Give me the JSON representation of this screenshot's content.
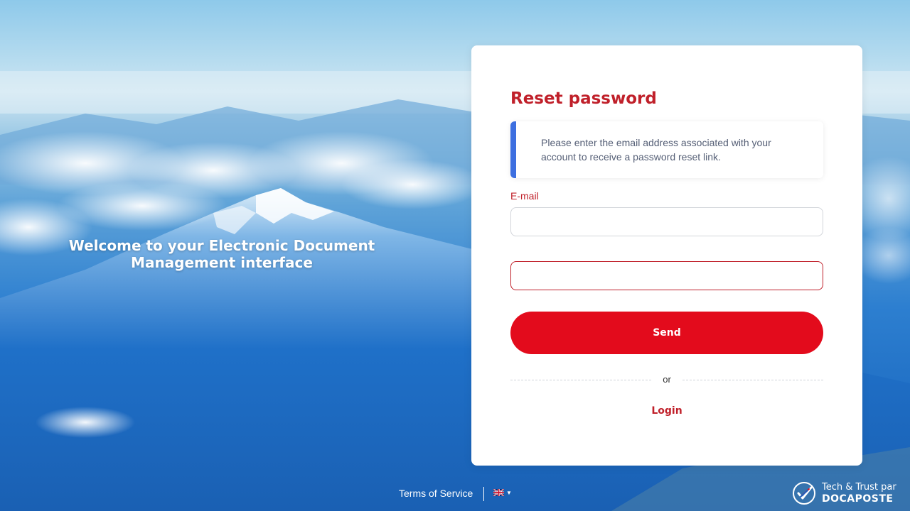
{
  "hero": {
    "welcome": "Welcome to your Electronic Document Management interface"
  },
  "card": {
    "title": "Reset password",
    "info": "Please enter the email address associated with your account to receive a password reset link.",
    "email_label": "E-mail",
    "email_value": "",
    "second_value": "",
    "send_label": "Send",
    "divider_text": "or",
    "login_label": "Login"
  },
  "footer": {
    "terms": "Terms of Service",
    "language_icon": "uk-flag-icon",
    "brand_tag": "Tech & Trust par",
    "brand_name": "DOCAPOSTE"
  },
  "colors": {
    "accent_red": "#e30b1c",
    "title_red": "#c0202a",
    "info_bar_blue": "#3d6fe0"
  }
}
